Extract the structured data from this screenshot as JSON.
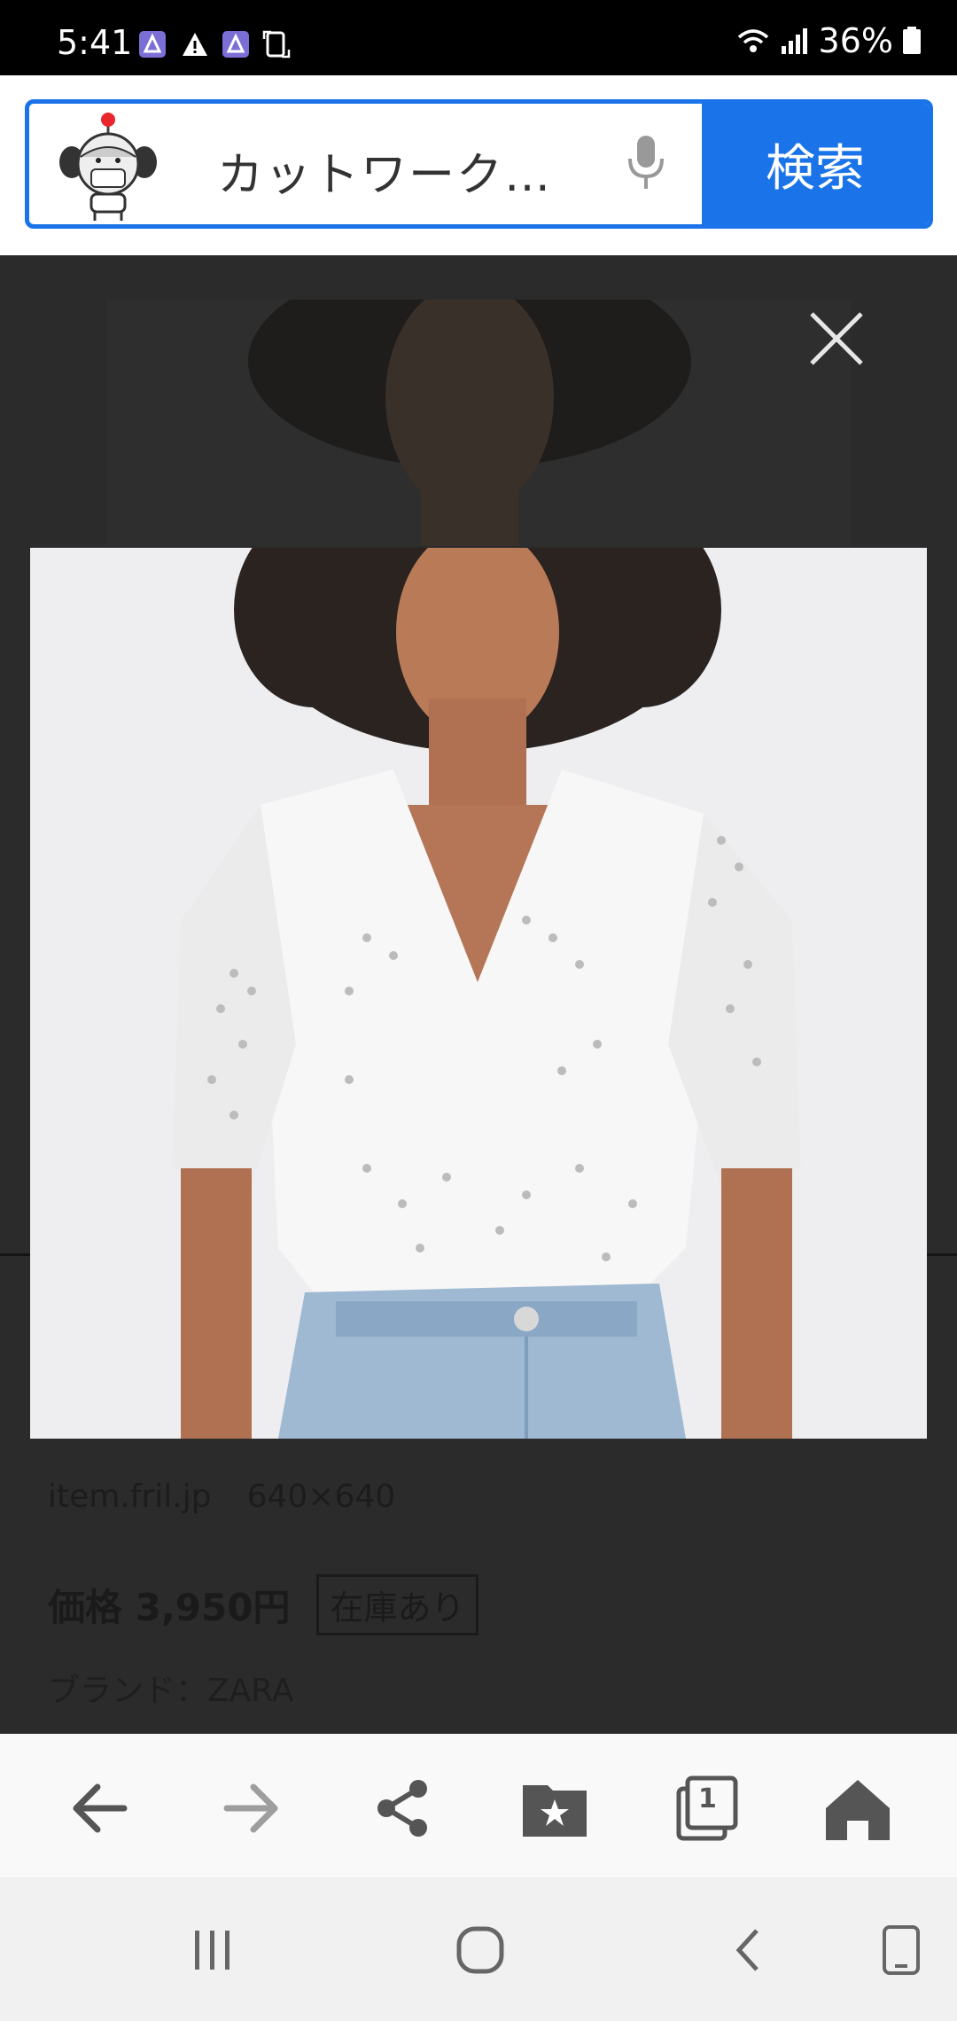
{
  "status_bar": {
    "time": "5:41",
    "battery": "36%",
    "notif_icons": [
      "news-app-icon",
      "warning-icon",
      "news-app-icon",
      "screenshot-icon"
    ],
    "system_icons": [
      "wifi-icon",
      "signal-icon",
      "battery-icon"
    ]
  },
  "search": {
    "query": "カットワーク…",
    "button_label": "検索",
    "accent": "#1a73e8"
  },
  "viewer": {
    "source": "item.fril.jp",
    "dimensions": "640×640",
    "price": "価格 3,950円",
    "stock_badge": "在庫あり",
    "brand": "ブランド：ZARA"
  },
  "toolbar": {
    "icons": [
      "back-icon",
      "forward-icon",
      "share-icon",
      "bookmark-icon",
      "tabs-icon",
      "home-icon"
    ],
    "tab_count": "1"
  },
  "nav": {
    "icons": [
      "recents-icon",
      "home-circle-icon",
      "nav-back-icon",
      "rotate-icon"
    ]
  }
}
